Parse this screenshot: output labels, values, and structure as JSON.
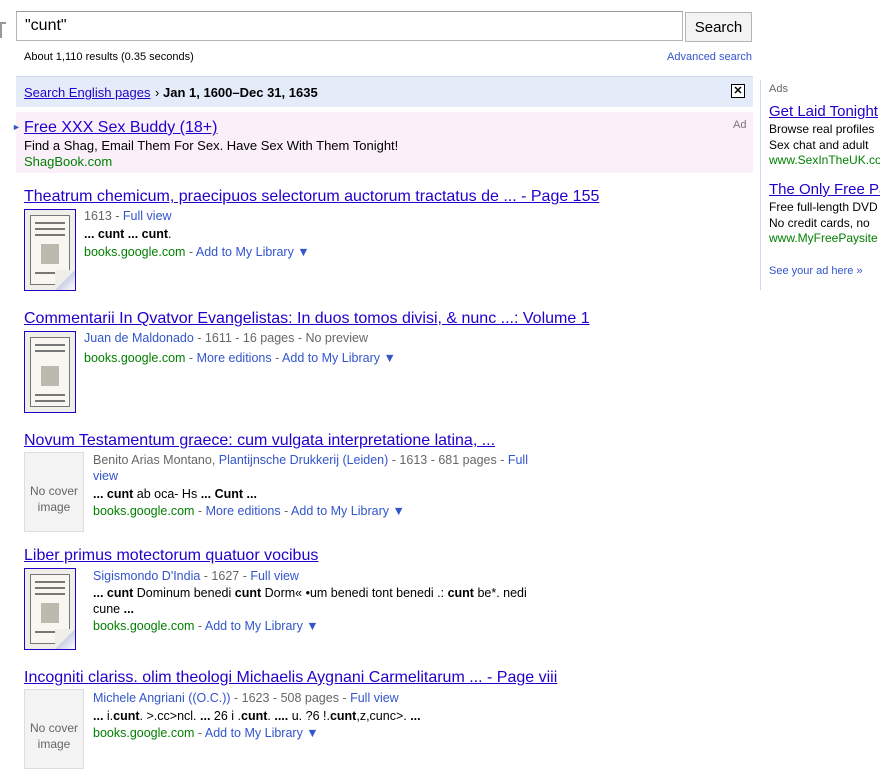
{
  "search": {
    "query": "\"cunt\"",
    "button_label": "Search"
  },
  "stats": {
    "text": "About 1,110 results (0.35 seconds)",
    "advanced_search": "Advanced search"
  },
  "filter": {
    "link": "Search English pages",
    "separator": "›",
    "range": "Jan 1, 1600–Dec 31, 1635",
    "close": "✕"
  },
  "top_ad": {
    "marker": "►",
    "title": "Free XXX Sex Buddy (18+)",
    "tag": "Ad",
    "description": "Find a Shag, Email Them For Sex. Have Sex With Them Tonight!",
    "url": "ShagBook.com"
  },
  "results": [
    {
      "title": "Theatrum chemicum, praecipuos selectorum auctorum tractatus de ... - Page 155",
      "meta_plain": "1613 - ",
      "meta_link": "Full view",
      "snippet_html": "<b>... cunt ... cunt</b>.",
      "url": "books.google.com",
      "links": [
        " - ",
        "Add to My Library ▼"
      ]
    },
    {
      "title": "Commentarii In Qvatvor Evangelistas: In duos tomos divisi, & nunc ...: Volume 1",
      "meta_link": "Juan de Maldonado",
      "meta_plain": " - 1611 - 16 pages - No preview",
      "url": "books.google.com",
      "links": [
        " - ",
        "More editions",
        " - ",
        "Add to My Library ▼"
      ]
    },
    {
      "title": "Novum Testamentum graece: cum vulgata interpretatione latina, ...",
      "cover": "No cover image",
      "meta_plain_1": "Benito Arias Montano, ",
      "meta_link_1": "Plantijnsche Drukkerij (Leiden)",
      "meta_plain_2": " - 1613 - 681 pages - ",
      "meta_link_2a": "Full",
      "meta_link_2b": "view",
      "snippet_html": "<b>...</b> <b>cunt</b> ab oca- Hs <b>... Cunt ...</b>",
      "url": "books.google.com",
      "links": [
        " - ",
        "More editions",
        " - ",
        "Add to My Library ▼"
      ]
    },
    {
      "title": "Liber primus motectorum quatuor vocibus",
      "meta_link": "Sigismondo D'India",
      "meta_plain": " - 1627 - ",
      "meta_link_2": "Full view",
      "snippet_html": "<b>...</b> <b>cunt</b> Dominum benedi <b>cunt</b> Dorm« •um benedi tont benedi .: <b>cunt</b> be*. nedi",
      "snippet_html_2": "cune <b>...</b>",
      "url": "books.google.com",
      "links": [
        " - ",
        "Add to My Library ▼"
      ]
    },
    {
      "title": "Incogniti clariss. olim theologi Michaelis Aygnani Carmelitarum ... - Page viii",
      "cover": "No cover image",
      "meta_link": "Michele Angriani ((O.C.))",
      "meta_plain": " - 1623 - 508 pages - ",
      "meta_link_2": "Full view",
      "snippet_html": "<b>...</b> i.<b>cunt</b>. &gt;.cc&gt;ncl. <b>...</b> 26 i .<b>cunt</b>. <b>....</b> u. ?6 !.<b>cunt</b>,z,cunc&gt;. <b>...</b>",
      "url": "books.google.com",
      "links": [
        " - ",
        "Add to My Library ▼"
      ]
    }
  ],
  "side_ads": {
    "label": "Ads",
    "items": [
      {
        "title": "Get Laid Tonight",
        "lines": [
          "Browse real profiles",
          "Sex chat and adult"
        ],
        "url": "www.SexInTheUK.co"
      },
      {
        "title": "The Only Free Pay",
        "lines": [
          "Free full-length DVD",
          "No credit cards, no"
        ],
        "url": "www.MyFreePaysite"
      }
    ],
    "see_your_ad": "See your ad here »"
  }
}
